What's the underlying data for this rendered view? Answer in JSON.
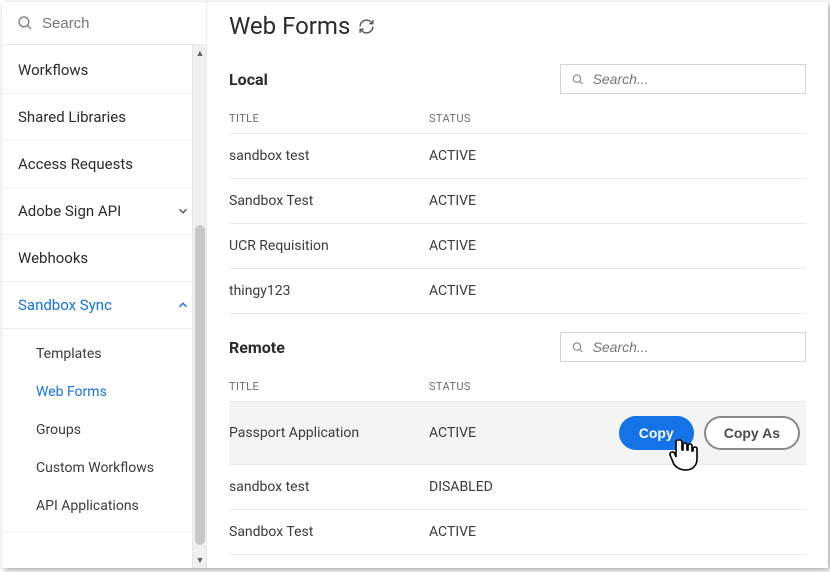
{
  "sidebar": {
    "search_placeholder": "Search",
    "items": [
      {
        "label": "Workflows"
      },
      {
        "label": "Shared Libraries"
      },
      {
        "label": "Access Requests"
      },
      {
        "label": "Adobe Sign API",
        "chevron": "down"
      },
      {
        "label": "Webhooks"
      },
      {
        "label": "Sandbox Sync",
        "chevron": "up",
        "active": true
      }
    ],
    "sub_items": [
      {
        "label": "Templates"
      },
      {
        "label": "Web Forms",
        "active": true
      },
      {
        "label": "Groups"
      },
      {
        "label": "Custom Workflows"
      },
      {
        "label": "API Applications"
      }
    ]
  },
  "page": {
    "title": "Web Forms"
  },
  "local": {
    "title": "Local",
    "search_placeholder": "Search...",
    "headers": {
      "title": "TITLE",
      "status": "STATUS"
    },
    "rows": [
      {
        "title": "sandbox test",
        "status": "ACTIVE"
      },
      {
        "title": "Sandbox Test",
        "status": "ACTIVE"
      },
      {
        "title": "UCR Requisition",
        "status": "ACTIVE"
      },
      {
        "title": "thingy123",
        "status": "ACTIVE"
      }
    ]
  },
  "remote": {
    "title": "Remote",
    "search_placeholder": "Search...",
    "headers": {
      "title": "TITLE",
      "status": "STATUS"
    },
    "rows": [
      {
        "title": "Passport Application",
        "status": "ACTIVE",
        "copy": "Copy",
        "copy_as": "Copy As",
        "highlight": true
      },
      {
        "title": "sandbox test",
        "status": "DISABLED"
      },
      {
        "title": "Sandbox Test",
        "status": "ACTIVE"
      }
    ]
  },
  "colors": {
    "accent": "#1473e6"
  }
}
